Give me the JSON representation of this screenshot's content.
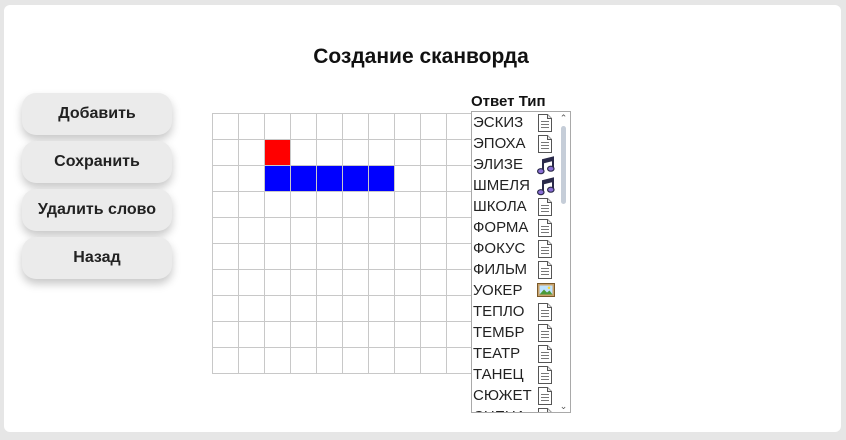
{
  "page": {
    "title": "Создание сканворда"
  },
  "buttons": {
    "add": "Добавить",
    "save": "Сохранить",
    "delete": "Удалить слово",
    "back": "Назад"
  },
  "grid": {
    "rows": 10,
    "cols": 10,
    "filled": [
      {
        "row": 1,
        "col": 2,
        "color": "#ff0000"
      },
      {
        "row": 2,
        "col": 2,
        "color": "#0000ff"
      },
      {
        "row": 2,
        "col": 3,
        "color": "#0000ff"
      },
      {
        "row": 2,
        "col": 4,
        "color": "#0000ff"
      },
      {
        "row": 2,
        "col": 5,
        "color": "#0000ff"
      },
      {
        "row": 2,
        "col": 6,
        "color": "#0000ff"
      }
    ]
  },
  "word_list": {
    "header": "Ответ Тип",
    "items": [
      {
        "word": "ЭСКИЗ",
        "type": "text-icon"
      },
      {
        "word": "ЭПОХА",
        "type": "text-icon"
      },
      {
        "word": "ЭЛИЗЕ",
        "type": "music-icon"
      },
      {
        "word": "ШМЕЛЯ",
        "type": "music-icon"
      },
      {
        "word": "ШКОЛА",
        "type": "text-icon"
      },
      {
        "word": "ФОРМА",
        "type": "text-icon"
      },
      {
        "word": "ФОКУС",
        "type": "text-icon"
      },
      {
        "word": "ФИЛЬМ",
        "type": "text-icon"
      },
      {
        "word": "УОКЕР",
        "type": "image-icon"
      },
      {
        "word": "ТЕПЛО",
        "type": "text-icon"
      },
      {
        "word": "ТЕМБР",
        "type": "text-icon"
      },
      {
        "word": "ТЕАТР",
        "type": "text-icon"
      },
      {
        "word": "ТАНЕЦ",
        "type": "text-icon"
      },
      {
        "word": "СЮЖЕТ",
        "type": "text-icon"
      },
      {
        "word": "СЦЕНА",
        "type": "text-icon"
      }
    ]
  }
}
